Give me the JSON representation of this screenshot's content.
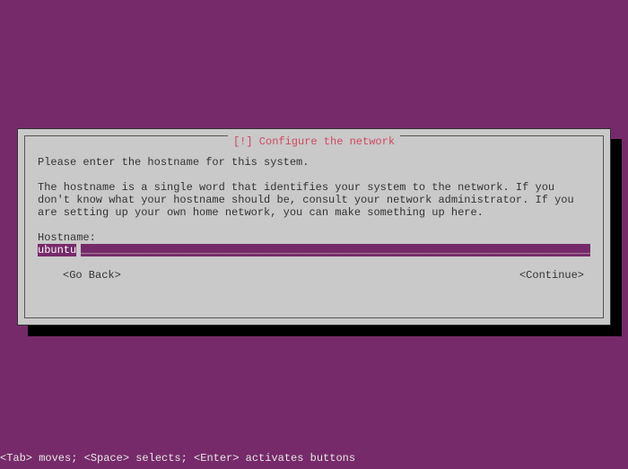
{
  "dialog": {
    "title": "[!] Configure the network",
    "prompt": "Please enter the hostname for this system.",
    "description": "The hostname is a single word that identifies your system to the network. If you don't know what your hostname should be, consult your network administrator. If you are setting up your own home network, you can make something up here.",
    "field_label": "Hostname:",
    "input_value": "ubuntu",
    "buttons": {
      "go_back": "<Go Back>",
      "continue": "<Continue>"
    }
  },
  "footer": {
    "help": "<Tab> moves; <Space> selects; <Enter> activates buttons"
  }
}
